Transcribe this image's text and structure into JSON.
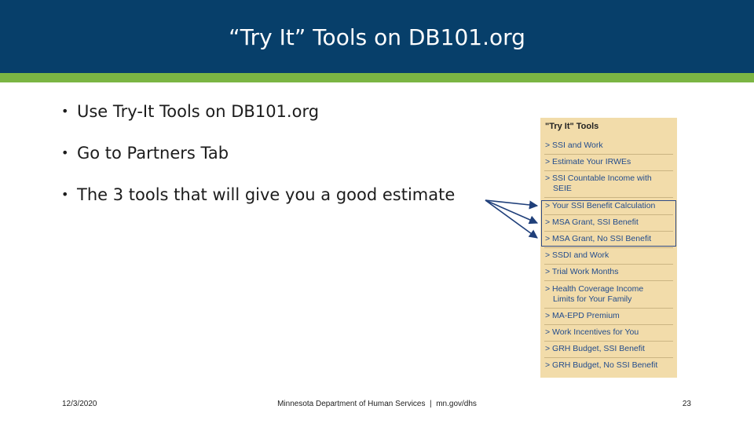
{
  "header": {
    "title": "“Try It” Tools on DB101.org"
  },
  "bullets": [
    {
      "marker": "•",
      "text": "Use Try-It Tools on DB101.org"
    },
    {
      "marker": "•",
      "text": "Go to Partners Tab"
    },
    {
      "marker": "•",
      "text": "The 3 tools that will give you a good estimate"
    }
  ],
  "tools_panel": {
    "heading": "\"Try It\" Tools",
    "items": [
      {
        "text": "> SSI and Work"
      },
      {
        "text": "> Estimate Your IRWEs"
      },
      {
        "text": "> SSI Countable Income with",
        "text2": "SEIE"
      },
      {
        "text": "> Your SSI Benefit Calculation"
      },
      {
        "text": "> MSA Grant, SSI Benefit"
      },
      {
        "text": "> MSA Grant, No SSI Benefit"
      },
      {
        "text": "> SSDI and Work"
      },
      {
        "text": "> Trial Work Months"
      },
      {
        "text": "> Health Coverage Income",
        "text2": "Limits for Your Family"
      },
      {
        "text": "> MA-EPD Premium"
      },
      {
        "text": "> Work Incentives for You"
      },
      {
        "text": "> GRH Budget, SSI Benefit"
      },
      {
        "text": "> GRH Budget, No SSI Benefit"
      }
    ]
  },
  "footer": {
    "date": "12/3/2020",
    "org": "Minnesota Department of Human Services  |  mn.gov/dhs",
    "page": "23"
  },
  "colors": {
    "header_bg": "#073f6a",
    "accent": "#7bb543",
    "panel_bg": "#f2dcaa",
    "link": "#234c8c",
    "highlight": "#2e4a86"
  }
}
